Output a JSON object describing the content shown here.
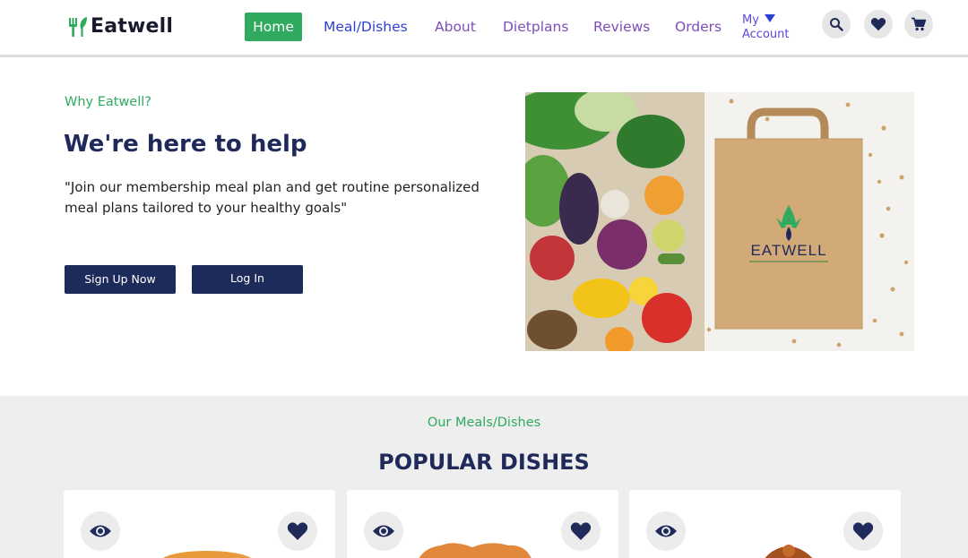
{
  "brand": {
    "name": "Eatwell"
  },
  "nav": {
    "home": "Home",
    "meals": "Meal/Dishes",
    "about": "About",
    "dietplans": "Dietplans",
    "reviews": "Reviews",
    "orders": "Orders",
    "account_line1": "My",
    "account_line2": "Account"
  },
  "header_icons": [
    "search-icon",
    "heart-icon",
    "cart-icon"
  ],
  "hero": {
    "kicker": "Why Eatwell?",
    "title": "We're here to help",
    "quote": "\"Join our membership meal plan and get routine personalized meal plans tailored to your healthy goals\"",
    "signup_label": "Sign Up Now",
    "login_label": "Log In",
    "image_brand": "EATWELL"
  },
  "dishes": {
    "kicker": "Our Meals/Dishes",
    "title": "POPULAR DISHES",
    "cards": [
      {
        "view_icon": "eye-icon",
        "fav_icon": "heart-icon"
      },
      {
        "view_icon": "eye-icon",
        "fav_icon": "heart-icon"
      },
      {
        "view_icon": "eye-icon",
        "fav_icon": "heart-icon"
      }
    ]
  },
  "colors": {
    "accent_green": "#2faa5e",
    "navy": "#1c2b5a",
    "nav_purple": "#7b4fb8",
    "nav_blue": "#2f3fd6"
  }
}
